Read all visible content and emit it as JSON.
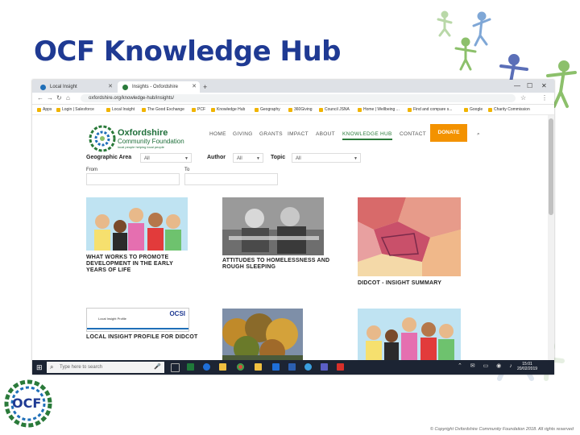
{
  "slide": {
    "title": "OCF Knowledge Hub",
    "logo_text": "OCF",
    "copyright": "© Copyright Oxfordshire Community Foundation 2018. All rights reserved"
  },
  "browser": {
    "tabs": [
      {
        "label": "Local Insight"
      },
      {
        "label": "Insights - Oxfordshire Communi..."
      }
    ],
    "new_tab": "+",
    "url": "oxfordshire.org/knowledge-hub/insights/",
    "bookmarks": [
      "Apps",
      "Login | Salesforce",
      "Local Insight",
      "The Good Exchange",
      "PCF",
      "Knowledge Hub",
      "Geography",
      "360Giving",
      "Council JSNA",
      "Home | Wellbeing ...",
      "Find and compare s...",
      "Google",
      "Charity Commission"
    ]
  },
  "site": {
    "logo": {
      "line1": "Oxfordshire",
      "line2": "Community Foundation",
      "tagline": "local people helping local people"
    },
    "menu": [
      "HOME",
      "GIVING",
      "GRANTS",
      "IMPACT",
      "ABOUT",
      "KNOWLEDGE HUB",
      "CONTACT"
    ],
    "donate": "DONATE",
    "filters": {
      "geographic_area_label": "Geographic Area",
      "geographic_area_value": "All",
      "author_label": "Author",
      "author_value": "All",
      "topic_label": "Topic",
      "topic_value": "All",
      "from_label": "From",
      "to_label": "To"
    },
    "cards": [
      {
        "title": "WHAT WORKS TO PROMOTE DEVELOPMENT IN THE EARLY YEARS OF LIFE"
      },
      {
        "title": "ATTITUDES TO HOMELESSNESS AND ROUGH SLEEPING"
      },
      {
        "title": "DIDCOT - INSIGHT SUMMARY"
      },
      {
        "title": "LOCAL INSIGHT PROFILE FOR DIDCOT"
      }
    ],
    "ocsi_label": "OCSI",
    "ocsi_sub": "Local Insight Profile"
  },
  "taskbar": {
    "search_placeholder": "Type here to search",
    "time": "15:01",
    "date": "20/02/2019"
  },
  "colors": {
    "title": "#1f3a93",
    "donate": "#f39200",
    "green": "#2a7a3a"
  }
}
